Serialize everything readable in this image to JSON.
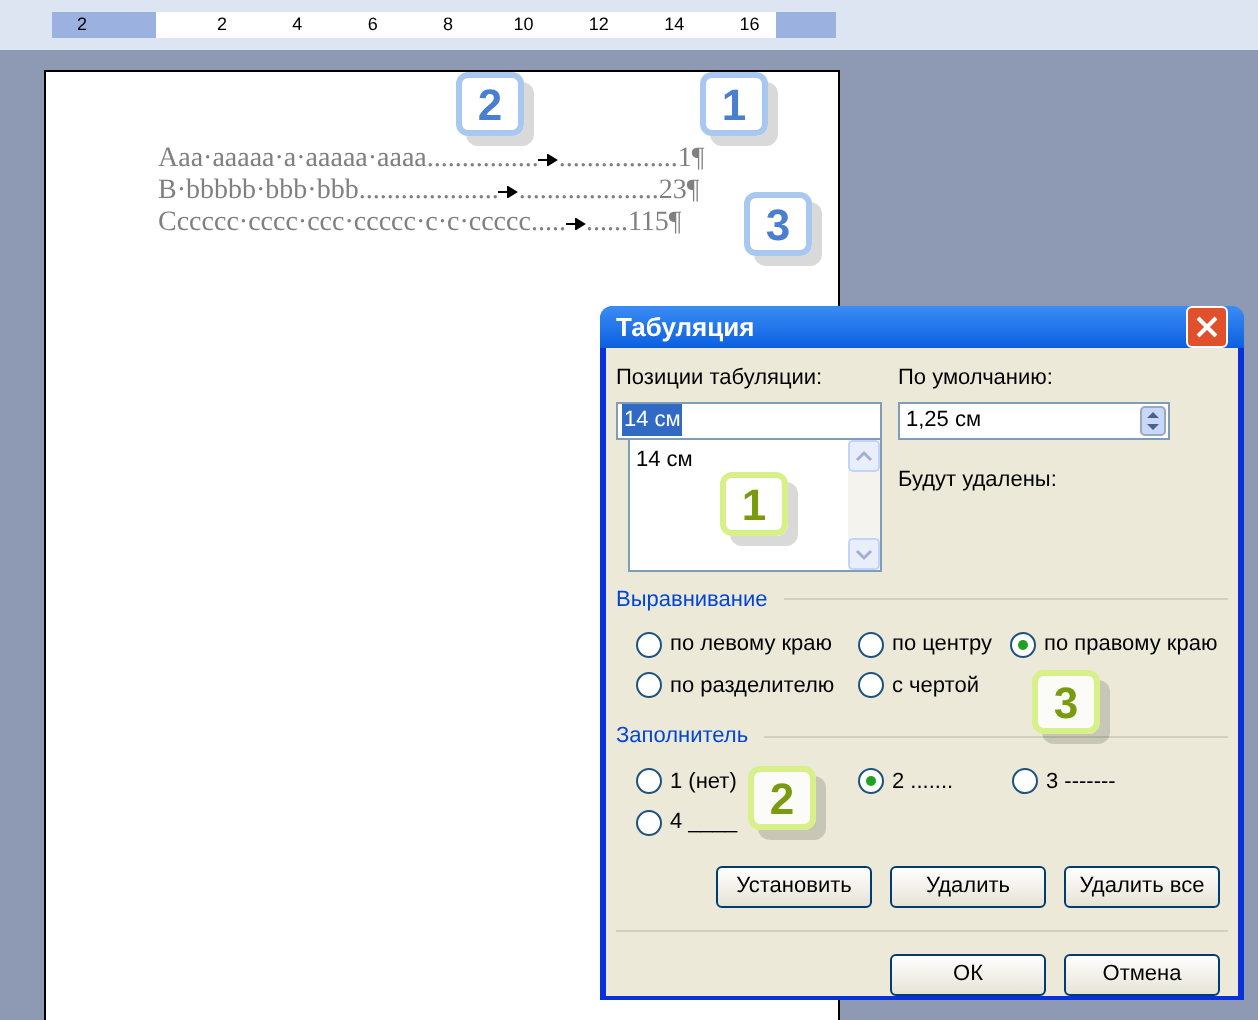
{
  "ruler": {
    "labels": [
      "2",
      "2",
      "4",
      "6",
      "8",
      "10",
      "12",
      "14",
      "16"
    ]
  },
  "document": {
    "lines": [
      {
        "text": "Aaa·aaaaa·a·aaaaa·aaaa",
        "leader": "................",
        "leader2": ".................",
        "number": "1¶"
      },
      {
        "text": "B·bbbbb·bbb·bbb",
        "leader": "....................",
        "leader2": "....................",
        "number": "23¶"
      },
      {
        "text": "Cccccc·cccc·ccc·ccccc·c·c·ccccc",
        "leader": ".....",
        "leader2": "......",
        "number": "115¶"
      }
    ]
  },
  "dialog": {
    "title": "Табуляция",
    "tab_positions": {
      "label": "Позиции табуляции:",
      "value": "14 см",
      "items": [
        "14 см"
      ]
    },
    "default": {
      "label": "По умолчанию:",
      "value": "1,25 см"
    },
    "to_delete": {
      "label": "Будут удалены:"
    },
    "alignment": {
      "label": "Выравнивание",
      "options": [
        {
          "label": "по левому краю",
          "selected": false
        },
        {
          "label": "по центру",
          "selected": false
        },
        {
          "label": "по правому краю",
          "selected": true
        },
        {
          "label": "по разделителю",
          "selected": false
        },
        {
          "label": "с чертой",
          "selected": false
        }
      ]
    },
    "filler": {
      "label": "Заполнитель",
      "options": [
        {
          "label": "1 (нет)",
          "selected": false
        },
        {
          "label": "2 .......",
          "selected": true
        },
        {
          "label": "3 -------",
          "selected": false
        },
        {
          "label": "4 ____",
          "selected": false
        }
      ]
    },
    "actions": [
      "Установить",
      "Удалить",
      "Удалить все"
    ],
    "buttons": [
      "ОК",
      "Отмена"
    ]
  },
  "callouts": [
    {
      "label": "1",
      "color": "#a8c8f0"
    },
    {
      "label": "2",
      "color": "#a8c8f0"
    },
    {
      "label": "3",
      "color": "#a8c8f0"
    },
    {
      "label": "1",
      "color": "#d8f08a"
    },
    {
      "label": "3",
      "color": "#d8f08a"
    },
    {
      "label": "2",
      "color": "#d8f08a"
    }
  ]
}
